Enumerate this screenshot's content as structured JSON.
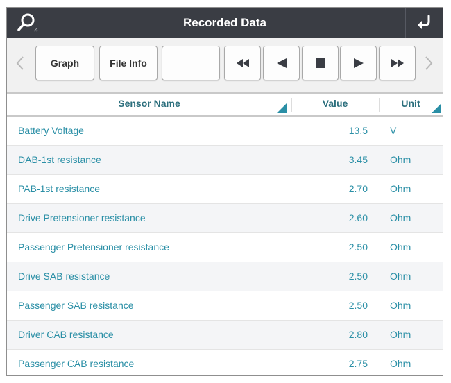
{
  "header": {
    "title": "Recorded Data",
    "left_icon": "search-icon",
    "right_icon": "back-arrow-icon"
  },
  "toolbar": {
    "graph_label": "Graph",
    "file_info_label": "File Info",
    "blank_label": "",
    "prev_icon": "chevron-left-icon",
    "next_icon": "chevron-right-icon",
    "playback": [
      "fast-rewind-icon",
      "step-back-icon",
      "stop-icon",
      "play-icon",
      "fast-forward-icon"
    ]
  },
  "table": {
    "columns": [
      "Sensor Name",
      "Value",
      "Unit"
    ],
    "rows": [
      {
        "name": "Battery Voltage",
        "value": "13.5",
        "unit": "V"
      },
      {
        "name": "DAB-1st resistance",
        "value": "3.45",
        "unit": "Ohm"
      },
      {
        "name": "PAB-1st resistance",
        "value": "2.70",
        "unit": "Ohm"
      },
      {
        "name": "Drive Pretensioner resistance",
        "value": "2.60",
        "unit": "Ohm"
      },
      {
        "name": "Passenger Pretensioner resistance",
        "value": "2.50",
        "unit": "Ohm"
      },
      {
        "name": "Drive SAB resistance",
        "value": "2.50",
        "unit": "Ohm"
      },
      {
        "name": "Passenger SAB resistance",
        "value": "2.50",
        "unit": "Ohm"
      },
      {
        "name": "Driver CAB resistance",
        "value": "2.80",
        "unit": "Ohm"
      },
      {
        "name": "Passenger CAB resistance",
        "value": "2.75",
        "unit": "Ohm"
      }
    ]
  },
  "colors": {
    "title_bar": "#3a3d44",
    "accent_text": "#2a8fa6",
    "header_text": "#2c6f7d"
  }
}
